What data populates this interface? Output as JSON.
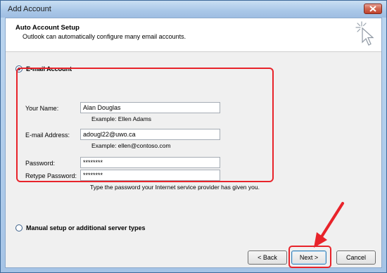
{
  "window": {
    "title": "Add Account"
  },
  "header": {
    "title": "Auto Account Setup",
    "subtitle": "Outlook can automatically configure many email accounts."
  },
  "options": {
    "email_account_label": "E-mail Account",
    "manual_setup_label": "Manual setup or additional server types"
  },
  "form": {
    "name_label": "Your Name:",
    "name_value": "Alan Douglas",
    "name_example": "Example: Ellen Adams",
    "email_label": "E-mail Address:",
    "email_value": "adougl22@uwo.ca",
    "email_example": "Example: ellen@contoso.com",
    "password_label": "Password:",
    "password_value": "********",
    "retype_label": "Retype Password:",
    "retype_value": "********",
    "password_hint": "Type the password your Internet service provider has given you."
  },
  "buttons": {
    "back": "< Back",
    "next": "Next >",
    "cancel": "Cancel"
  },
  "colors": {
    "annotation": "#e8232a",
    "title_bar": "#a9c7e8",
    "close_button": "#c0422c"
  }
}
